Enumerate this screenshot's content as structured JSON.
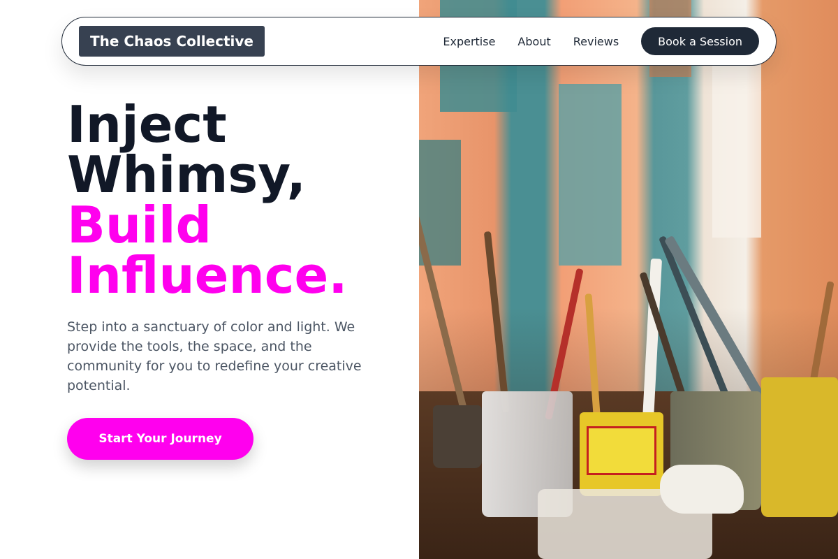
{
  "brand": {
    "name": "The Chaos Collective"
  },
  "nav": {
    "links": [
      "Expertise",
      "About",
      "Reviews"
    ],
    "book_label": "Book a Session"
  },
  "hero": {
    "title_line1": "Inject",
    "title_line2": "Whimsy,",
    "title_accent_line1": "Build",
    "title_accent_line2": "Influence.",
    "description": "Step into a sanctuary of color and light. We provide the tools, the space, and the community for you to redefine your creative potential.",
    "cta_label": "Start Your Journey"
  },
  "colors": {
    "accent": "#ff00ee",
    "dark": "#1f2937",
    "brand_bg": "#374151"
  }
}
